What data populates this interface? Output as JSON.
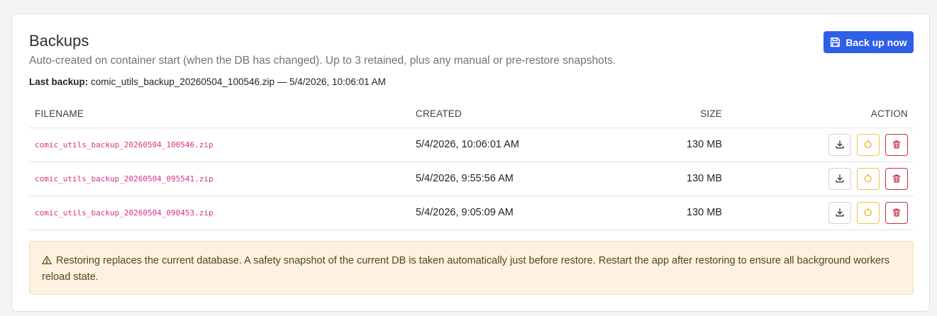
{
  "header": {
    "title": "Backups",
    "subtitle": "Auto-created on container start (when the DB has changed). Up to 3 retained, plus any manual or pre-restore snapshots.",
    "last_backup_label": "Last backup:",
    "last_backup_value": "comic_utils_backup_20260504_100546.zip — 5/4/2026, 10:06:01 AM",
    "backup_now_label": "Back up now"
  },
  "table": {
    "columns": [
      "FILENAME",
      "CREATED",
      "SIZE",
      "ACTION"
    ],
    "rows": [
      {
        "filename": "comic_utils_backup_20260504_100546.zip",
        "created": "5/4/2026, 10:06:01 AM",
        "size": "130 MB"
      },
      {
        "filename": "comic_utils_backup_20260504_095541.zip",
        "created": "5/4/2026, 9:55:56 AM",
        "size": "130 MB"
      },
      {
        "filename": "comic_utils_backup_20260504_090453.zip",
        "created": "5/4/2026, 9:05:09 AM",
        "size": "130 MB"
      }
    ],
    "action_icons": [
      "download-icon",
      "restore-icon",
      "trash-icon"
    ]
  },
  "warning": {
    "icon": "warning-triangle-icon",
    "text": "Restoring replaces the current database. A safety snapshot of the current DB is taken automatically just before restore. Restart the app after restoring to ensure all background workers reload state."
  },
  "colors": {
    "primary": "#2f5fe8",
    "filename": "#d63384",
    "restore": "#f3c14b",
    "danger": "#c9303e",
    "warning_bg": "#fdf2df"
  }
}
